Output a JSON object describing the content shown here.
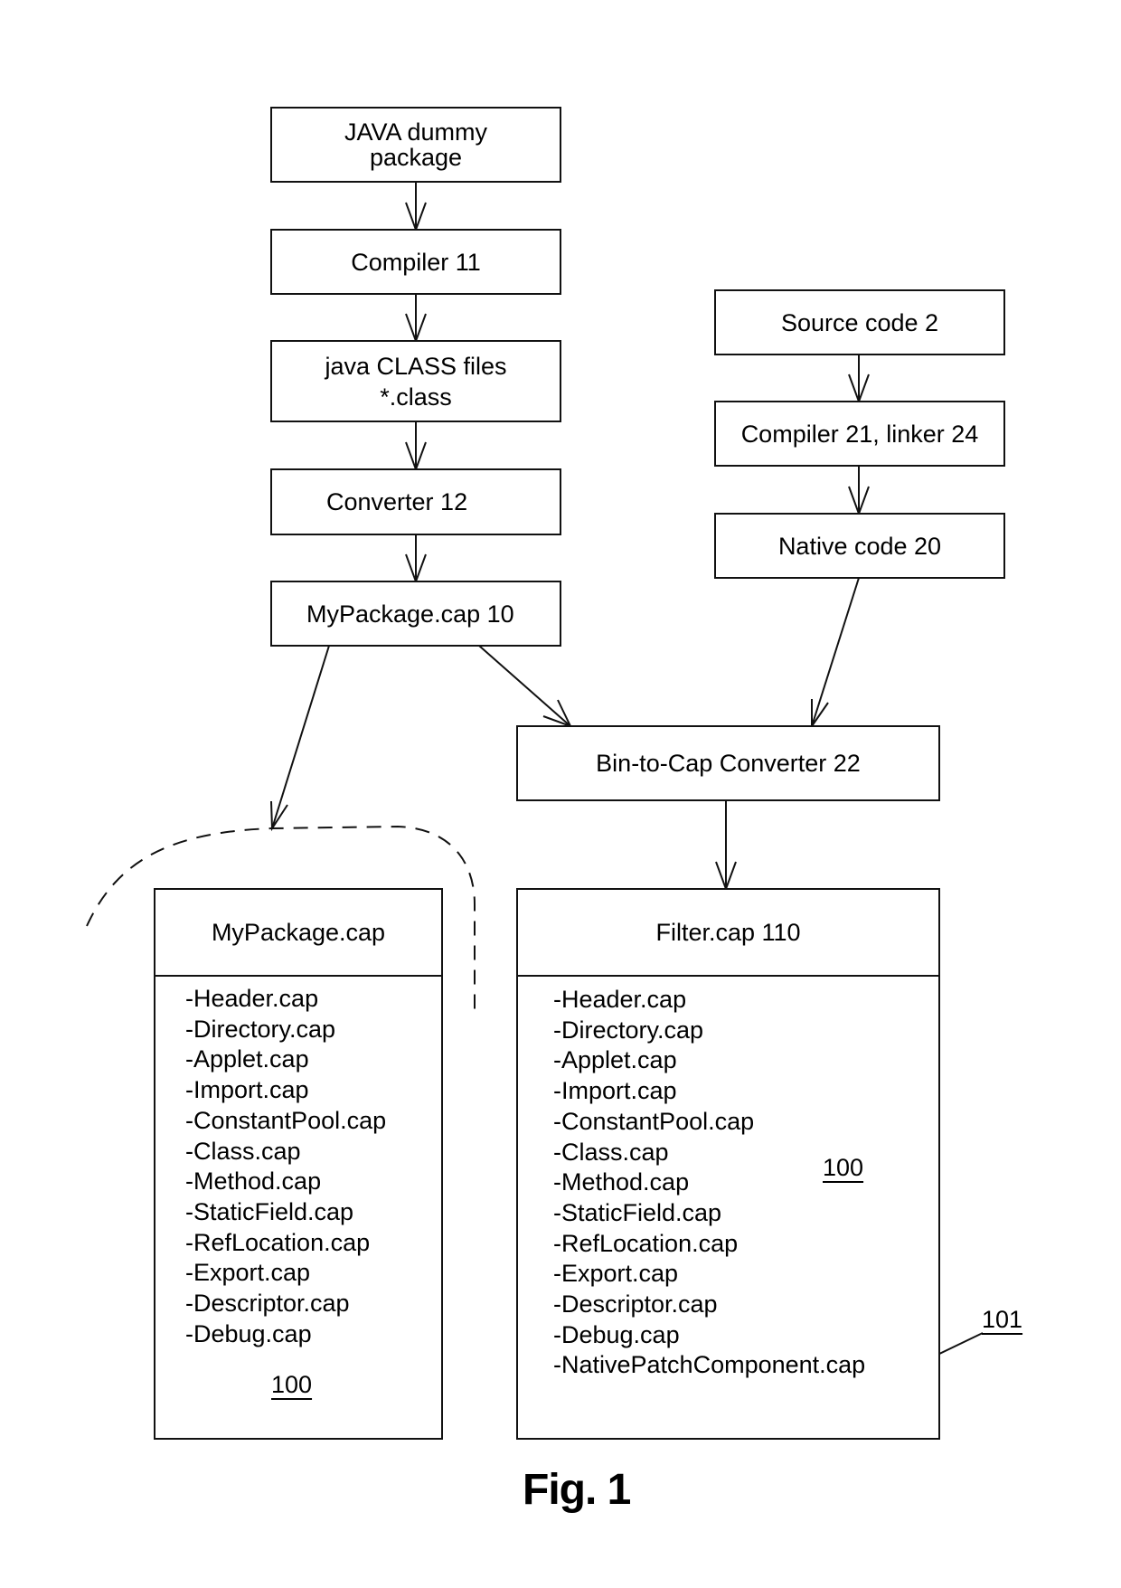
{
  "figure": {
    "caption": "Fig. 1"
  },
  "left_chain": {
    "java_dummy_package": [
      "JAVA dummy",
      "package"
    ],
    "compiler": "Compiler 11",
    "class_files": [
      "java CLASS files",
      "*.class"
    ],
    "converter": "Converter 12",
    "mypackage_cap": "MyPackage.cap 10"
  },
  "right_chain": {
    "source_code": "Source code 2",
    "compiler_linker": "Compiler 21, linker 24",
    "native_code": "Native code 20"
  },
  "bin_to_cap": "Bin-to-Cap Converter 22",
  "mypackage_detail": {
    "title": "MyPackage.cap",
    "components": [
      "-Header.cap",
      "-Directory.cap",
      "-Applet.cap",
      "-Import.cap",
      "-ConstantPool.cap",
      "-Class.cap",
      "-Method.cap",
      "-StaticField.cap",
      "-RefLocation.cap",
      "-Export.cap",
      "-Descriptor.cap",
      "-Debug.cap"
    ],
    "ref_label": "100"
  },
  "filter_detail": {
    "title": "Filter.cap 110",
    "components": [
      "-Header.cap",
      "-Directory.cap",
      "-Applet.cap",
      "-Import.cap",
      "-ConstantPool.cap",
      "-Class.cap",
      "-Method.cap",
      "-StaticField.cap",
      "-RefLocation.cap",
      "-Export.cap",
      "-Descriptor.cap",
      "-Debug.cap",
      "-NativePatchComponent.cap"
    ],
    "brace_ref_label": "100",
    "native_ref_label": "101"
  }
}
